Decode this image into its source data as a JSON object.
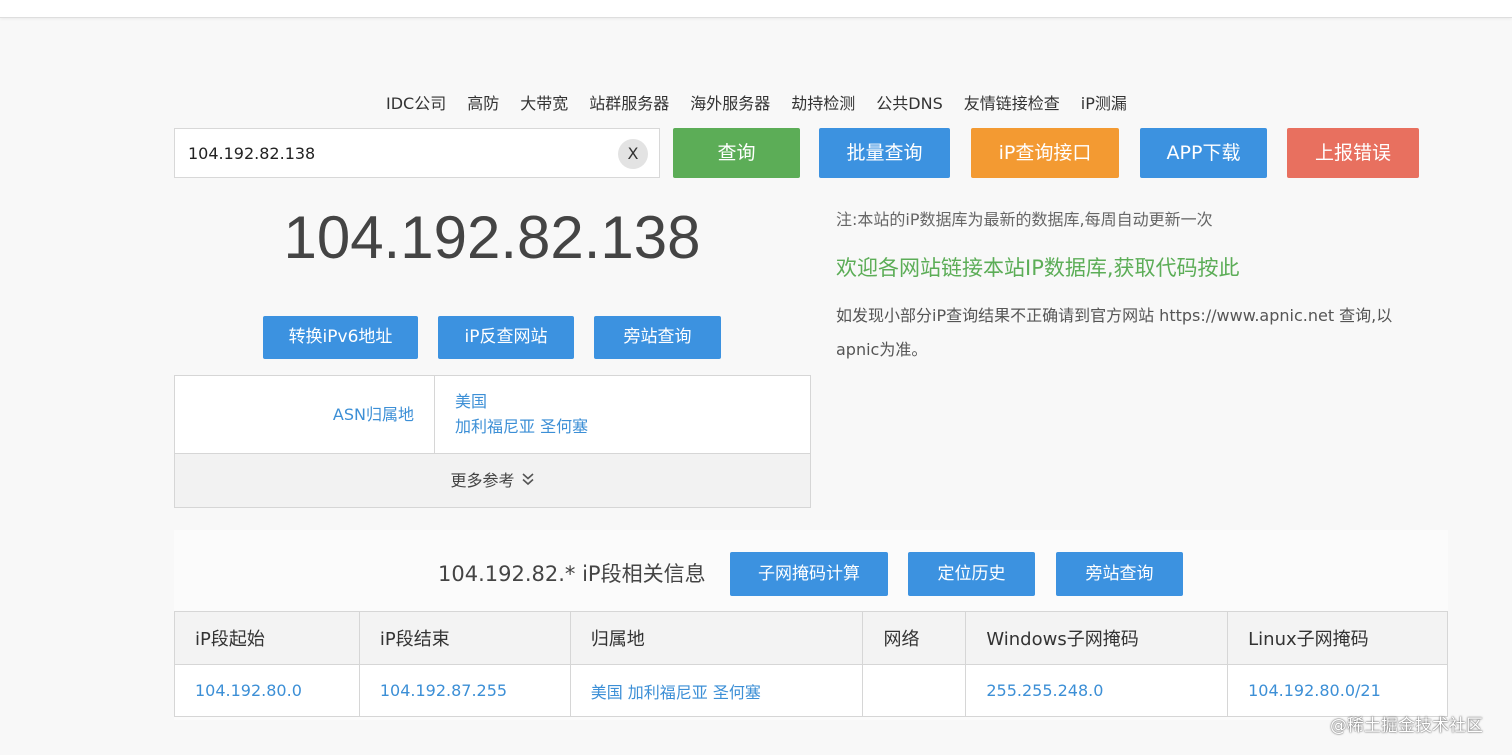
{
  "nav": [
    "IDC公司",
    "高防",
    "大带宽",
    "站群服务器",
    "海外服务器",
    "劫持检测",
    "公共DNS",
    "友情链接检查",
    "iP测漏"
  ],
  "search": {
    "value": "104.192.82.138",
    "clear": "X"
  },
  "actions": {
    "query": "查询",
    "batch": "批量查询",
    "api": "iP查询接口",
    "app": "APP下载",
    "report": "上报错误"
  },
  "ip": "104.192.82.138",
  "tools": {
    "ipv6": "转换iPv6地址",
    "reverse": "iP反查网站",
    "side": "旁站查询"
  },
  "notes": {
    "note1": "注:本站的iP数据库为最新的数据库,每周自动更新一次",
    "note2": "欢迎各网站链接本站IP数据库,获取代码按此",
    "note3": "如发现小部分iP查询结果不正确请到官方网站 https://www.apnic.net 查询,以apnic为准。"
  },
  "asn": {
    "label": "ASN归属地",
    "country": "美国",
    "region": "加利福尼亚 圣何塞",
    "more": "更多参考"
  },
  "segment": {
    "title": "104.192.82.* iP段相关信息",
    "subnet_calc": "子网掩码计算",
    "history": "定位历史",
    "side": "旁站查询",
    "headers": [
      "iP段起始",
      "iP段结束",
      "归属地",
      "网络",
      "Windows子网掩码",
      "Linux子网掩码"
    ],
    "row": [
      "104.192.80.0",
      "104.192.87.255",
      "美国 加利福尼亚 圣何塞",
      "",
      "255.255.248.0",
      "104.192.80.0/21"
    ]
  },
  "watermark": "@稀土掘金技术社区",
  "colors": {
    "green": "#5cad57",
    "blue": "#3c92e0",
    "orange": "#f39a32",
    "red": "#e8705f",
    "link": "#3c8fd6"
  }
}
